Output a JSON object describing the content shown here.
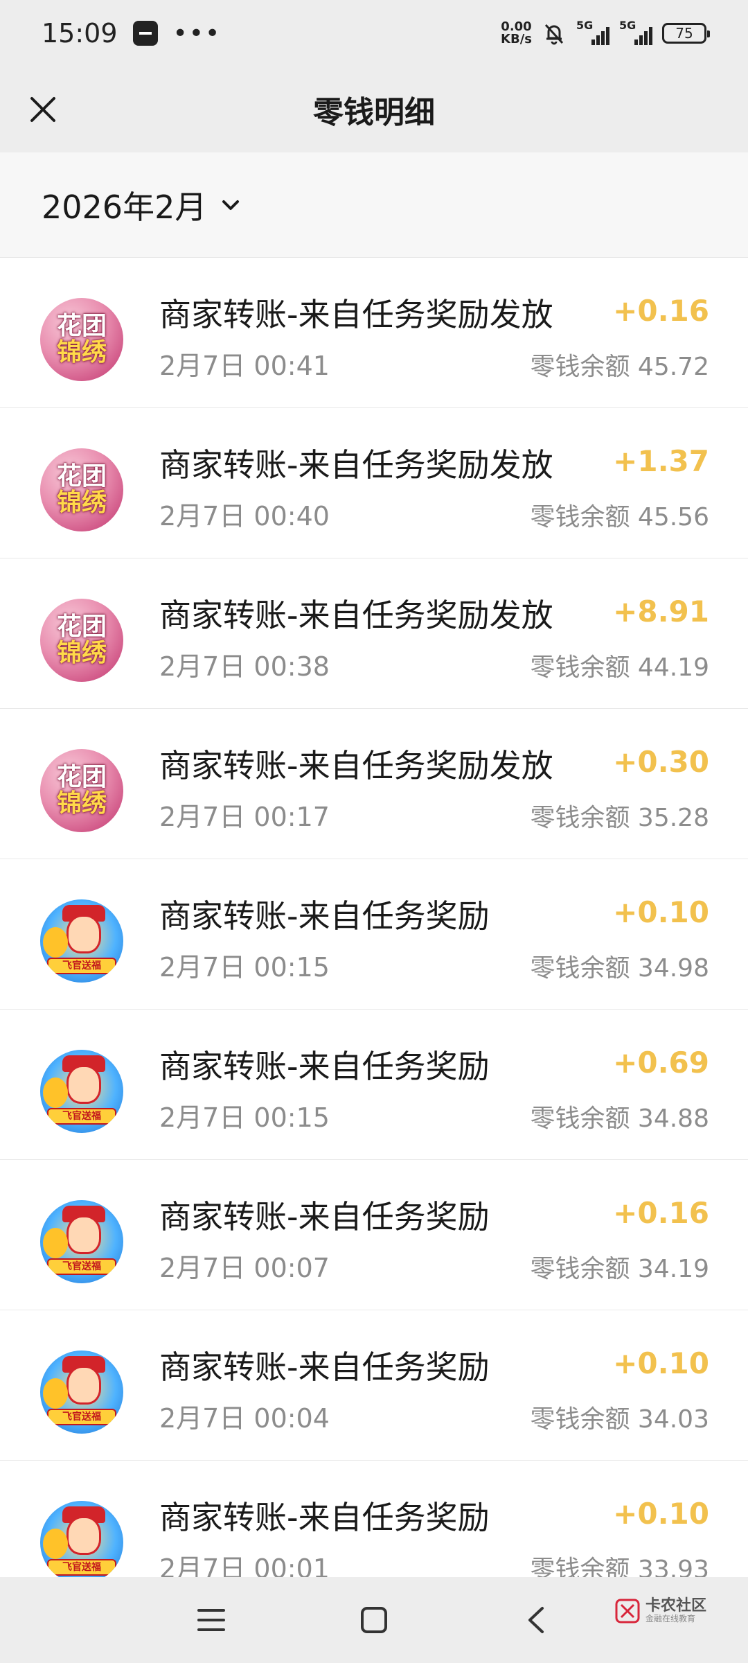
{
  "status_bar": {
    "time": "15:09",
    "net_speed_value": "0.00",
    "net_speed_unit": "KB/s",
    "signal1": "5G",
    "signal2": "5G",
    "battery": "75"
  },
  "nav": {
    "title": "零钱明细"
  },
  "filter": {
    "month": "2026年2月"
  },
  "transactions": [
    {
      "title": "商家转账-来自任务奖励发放",
      "time": "2月7日 00:41",
      "amount": "+0.16",
      "balance": "零钱余额 45.72",
      "avatar": "flower",
      "avatar_line1": "花团",
      "avatar_line2": "锦绣"
    },
    {
      "title": "商家转账-来自任务奖励发放",
      "time": "2月7日 00:40",
      "amount": "+1.37",
      "balance": "零钱余额 45.56",
      "avatar": "flower",
      "avatar_line1": "花团",
      "avatar_line2": "锦绣"
    },
    {
      "title": "商家转账-来自任务奖励发放",
      "time": "2月7日 00:38",
      "amount": "+8.91",
      "balance": "零钱余额 44.19",
      "avatar": "flower",
      "avatar_line1": "花团",
      "avatar_line2": "锦绣"
    },
    {
      "title": "商家转账-来自任务奖励发放",
      "time": "2月7日 00:17",
      "amount": "+0.30",
      "balance": "零钱余额 35.28",
      "avatar": "flower",
      "avatar_line1": "花团",
      "avatar_line2": "锦绣"
    },
    {
      "title": "商家转账-来自任务奖励",
      "time": "2月7日 00:15",
      "amount": "+0.10",
      "balance": "零钱余额 34.98",
      "avatar": "god",
      "avatar_line1": "飞官送福"
    },
    {
      "title": "商家转账-来自任务奖励",
      "time": "2月7日 00:15",
      "amount": "+0.69",
      "balance": "零钱余额 34.88",
      "avatar": "god",
      "avatar_line1": "飞官送福"
    },
    {
      "title": "商家转账-来自任务奖励",
      "time": "2月7日 00:07",
      "amount": "+0.16",
      "balance": "零钱余额 34.19",
      "avatar": "god",
      "avatar_line1": "飞官送福"
    },
    {
      "title": "商家转账-来自任务奖励",
      "time": "2月7日 00:04",
      "amount": "+0.10",
      "balance": "零钱余额 34.03",
      "avatar": "god",
      "avatar_line1": "飞官送福"
    },
    {
      "title": "商家转账-来自任务奖励",
      "time": "2月7日 00:01",
      "amount": "+0.10",
      "balance": "零钱余额 33.93",
      "avatar": "god",
      "avatar_line1": "飞官送福"
    }
  ],
  "watermark": {
    "main": "卡农社区",
    "sub": "金融在线教育"
  },
  "colors": {
    "amount": "#f2c14e",
    "secondary_text": "#8c8c8c",
    "bar_bg": "#ededed"
  },
  "icons": {
    "close": "close-icon",
    "month_dropdown": "chevron-down-icon",
    "sys_menu": "menu-icon",
    "sys_home": "home-square-icon",
    "sys_back": "back-chevron-icon"
  }
}
